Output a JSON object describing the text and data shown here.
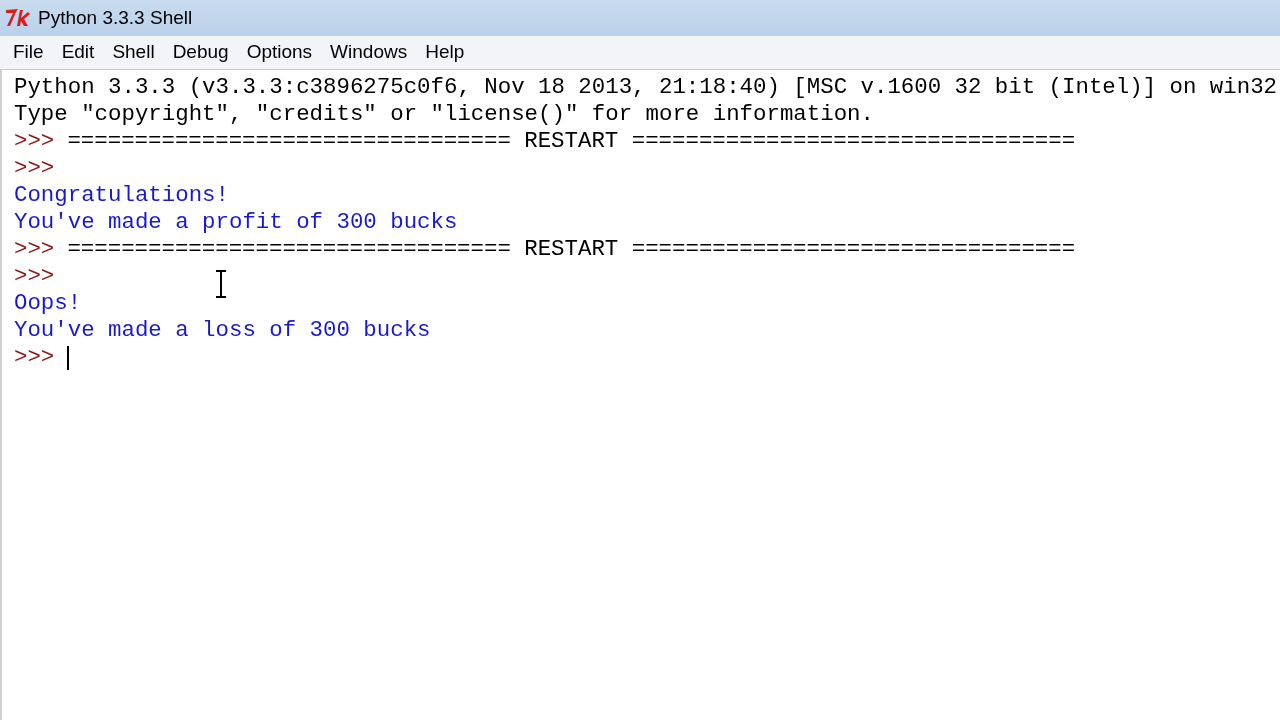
{
  "window": {
    "title": "Python 3.3.3 Shell"
  },
  "menu": [
    "File",
    "Edit",
    "Shell",
    "Debug",
    "Options",
    "Windows",
    "Help"
  ],
  "lines": [
    {
      "kind": "output",
      "text": "Python 3.3.3 (v3.3.3:c3896275c0f6, Nov 18 2013, 21:18:40) [MSC v.1600 32 bit (Intel)] on win32"
    },
    {
      "kind": "output",
      "text": "Type \"copyright\", \"credits\" or \"license()\" for more information."
    },
    {
      "kind": "prompt",
      "prompt": ">>>",
      "text": "================================= RESTART ================================="
    },
    {
      "kind": "prompt",
      "prompt": ">>>"
    },
    {
      "kind": "stdout",
      "text": "Congratulations!"
    },
    {
      "kind": "stdout",
      "text": "You've made a profit of 300 bucks"
    },
    {
      "kind": "prompt",
      "prompt": ">>>",
      "text": "================================= RESTART ================================="
    },
    {
      "kind": "prompt",
      "prompt": ">>>"
    },
    {
      "kind": "stdout",
      "text": "Oops!"
    },
    {
      "kind": "stdout",
      "text": "You've made a loss of 300 bucks"
    },
    {
      "kind": "prompt",
      "prompt": ">>>",
      "cursor": true
    }
  ]
}
